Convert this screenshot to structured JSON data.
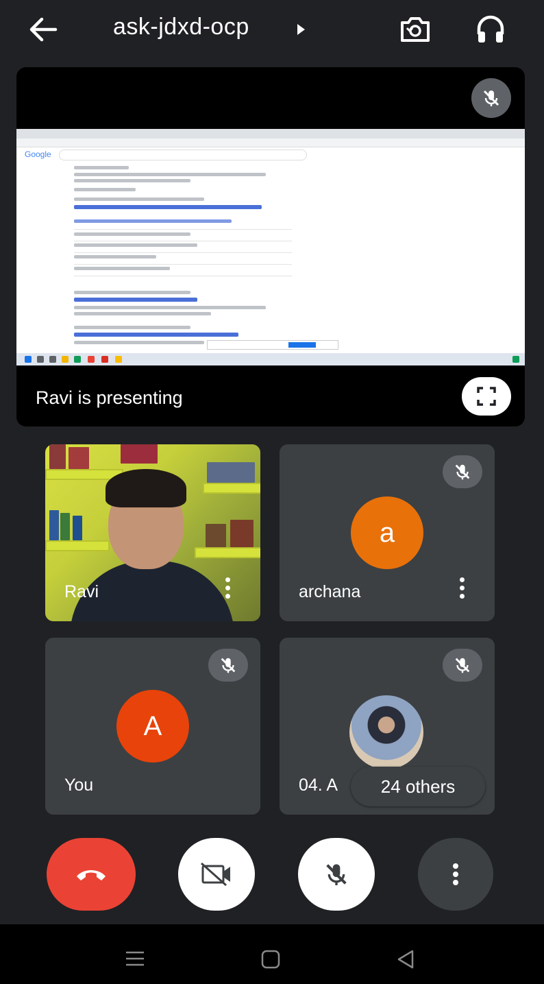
{
  "header": {
    "meeting_code": "ask-jdxd-ocp",
    "icons": [
      "back-arrow-icon",
      "caret-right-icon",
      "switch-camera-icon",
      "headphones-icon"
    ]
  },
  "presentation": {
    "presenter_label": "Ravi is presenting",
    "icons": [
      "mic-off-icon",
      "fullscreen-icon"
    ],
    "shared_screen": {
      "browser_logo": "Google"
    }
  },
  "participants": [
    {
      "name": "Ravi",
      "type": "video",
      "muted": false
    },
    {
      "name": "archana",
      "initial": "a",
      "avatar_color": "#e8710a",
      "muted": true
    },
    {
      "name": "You",
      "initial": "A",
      "avatar_color": "#e8430a",
      "muted": true
    },
    {
      "name": "04. A",
      "type": "photo",
      "muted": true
    }
  ],
  "others_chip": "24 others",
  "controls": {
    "end_call_color": "#ea4335",
    "icons": [
      "end-call-icon",
      "camera-off-icon",
      "mic-off-icon",
      "more-vert-icon"
    ]
  },
  "system_nav": {
    "icons": [
      "recents-icon",
      "home-icon",
      "back-triangle-icon"
    ]
  }
}
